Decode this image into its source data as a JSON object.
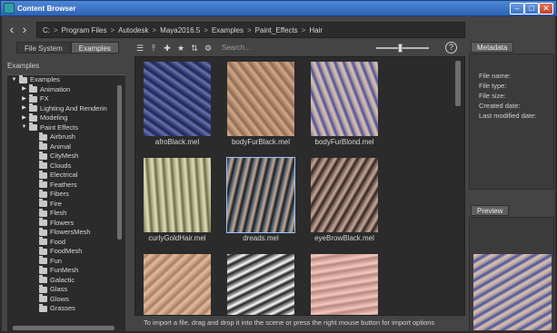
{
  "window": {
    "title": "Content Browser",
    "buttons": {
      "minimize": "–",
      "maximize": "□",
      "close": "✕"
    }
  },
  "nav": {
    "back_glyph": "‹",
    "forward_glyph": "›",
    "breadcrumbs": [
      "C:",
      "Program Files",
      "Autodesk",
      "Maya2016.5",
      "Examples",
      "Paint_Effects",
      "Hair"
    ],
    "separator": ">"
  },
  "tabs": [
    "File System",
    "Examples"
  ],
  "active_tab": "Examples",
  "tree": {
    "heading": "Examples",
    "items": [
      {
        "label": "Examples",
        "depth": 0,
        "expander": "▼"
      },
      {
        "label": "Animation",
        "depth": 1,
        "expander": "▶"
      },
      {
        "label": "FX",
        "depth": 1,
        "expander": "▶"
      },
      {
        "label": "Lighting And Renderin",
        "depth": 1,
        "expander": "▶"
      },
      {
        "label": "Modeling",
        "depth": 1,
        "expander": "▶"
      },
      {
        "label": "Paint Effects",
        "depth": 1,
        "expander": "▼"
      },
      {
        "label": "Airbrush",
        "depth": 2,
        "expander": ""
      },
      {
        "label": "Animal",
        "depth": 2,
        "expander": ""
      },
      {
        "label": "CityMesh",
        "depth": 2,
        "expander": ""
      },
      {
        "label": "Clouds",
        "depth": 2,
        "expander": ""
      },
      {
        "label": "Electrical",
        "depth": 2,
        "expander": ""
      },
      {
        "label": "Feathers",
        "depth": 2,
        "expander": ""
      },
      {
        "label": "Fibers",
        "depth": 2,
        "expander": ""
      },
      {
        "label": "Fire",
        "depth": 2,
        "expander": ""
      },
      {
        "label": "Flesh",
        "depth": 2,
        "expander": ""
      },
      {
        "label": "Flowers",
        "depth": 2,
        "expander": ""
      },
      {
        "label": "FlowersMesh",
        "depth": 2,
        "expander": ""
      },
      {
        "label": "Food",
        "depth": 2,
        "expander": ""
      },
      {
        "label": "FoodMesh",
        "depth": 2,
        "expander": ""
      },
      {
        "label": "Fun",
        "depth": 2,
        "expander": ""
      },
      {
        "label": "FunMesh",
        "depth": 2,
        "expander": ""
      },
      {
        "label": "Galactic",
        "depth": 2,
        "expander": ""
      },
      {
        "label": "Glass",
        "depth": 2,
        "expander": ""
      },
      {
        "label": "Glows",
        "depth": 2,
        "expander": ""
      },
      {
        "label": "Grasses",
        "depth": 2,
        "expander": ""
      }
    ]
  },
  "toolbar": {
    "icons": [
      {
        "name": "list-view-icon",
        "glyph": "☰"
      },
      {
        "name": "import-icon",
        "glyph": "⤒"
      },
      {
        "name": "new-folder-icon",
        "glyph": "✚"
      },
      {
        "name": "favorite-star-icon",
        "glyph": "★"
      },
      {
        "name": "sort-icon",
        "glyph": "⇅"
      },
      {
        "name": "settings-gear-icon",
        "glyph": "⚙"
      }
    ],
    "search_placeholder": "Search...",
    "help_glyph": "?",
    "thumbnail_size_level": 0.45
  },
  "files": [
    {
      "name": "afroBlack.mel",
      "colors": [
        "#1c2456",
        "#3a4583",
        "#6b74a8"
      ]
    },
    {
      "name": "bodyFurBlack.mel",
      "colors": [
        "#b58a6e",
        "#d2a98a",
        "#8d6a55"
      ]
    },
    {
      "name": "bodyFurBlond.mel",
      "colors": [
        "#4a4f9c",
        "#b6a2a0",
        "#d9c3b2"
      ]
    },
    {
      "name": "curlyGoldHair.mel",
      "colors": [
        "#6c6a44",
        "#b8b48a",
        "#dedcc0"
      ]
    },
    {
      "name": "dreads.mel",
      "colors": [
        "#1b1b1b",
        "#5a6f7f",
        "#c7a995"
      ]
    },
    {
      "name": "eyeBrowBlack.mel",
      "colors": [
        "#2d241f",
        "#8a6e60",
        "#c8a89a"
      ]
    },
    {
      "name": "",
      "colors": [
        "#c9a080",
        "#a67d62",
        "#e0bca0"
      ]
    },
    {
      "name": "",
      "colors": [
        "#ffffff",
        "#222222",
        "#888888"
      ]
    },
    {
      "name": "",
      "colors": [
        "#d8a8a0",
        "#f2c8c0",
        "#b88880"
      ]
    }
  ],
  "status": "To import a file, drag and drop it into the scene or press the right mouse button for import options",
  "metadata": {
    "tab_label": "Metadata",
    "fields": [
      "File name:",
      "File type:",
      "File size:",
      "Created date:",
      "Last modified date:"
    ]
  },
  "preview": {
    "tab_label": "Preview",
    "colors": [
      "#4a4f9c",
      "#b6a2a0",
      "#d9c3b2"
    ]
  }
}
